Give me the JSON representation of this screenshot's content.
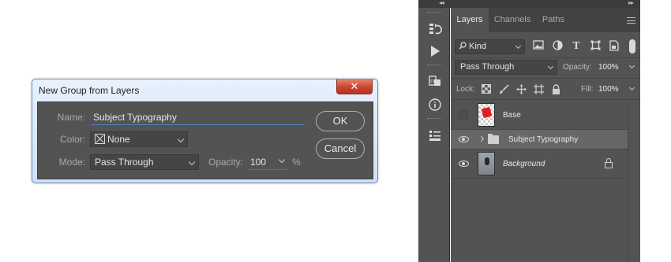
{
  "dialog": {
    "title": "New Group from Layers",
    "close_glyph": "✕",
    "name_label": "Name:",
    "name_value": "Subject Typography",
    "color_label": "Color:",
    "color_value": "None",
    "mode_label": "Mode:",
    "mode_value": "Pass Through",
    "opacity_label": "Opacity:",
    "opacity_value": "100",
    "opacity_unit": "%",
    "ok_label": "OK",
    "cancel_label": "Cancel"
  },
  "panel": {
    "strip_left_arrows": "◂◂",
    "strip_right_arrows": "▸▸",
    "tabs": [
      {
        "label": "Layers",
        "active": true
      },
      {
        "label": "Channels",
        "active": false
      },
      {
        "label": "Paths",
        "active": false
      }
    ],
    "filter": {
      "kind_value": "Kind",
      "icons": [
        "image-filter-icon",
        "adjustment-filter-icon",
        "type-filter-icon",
        "shape-filter-icon",
        "smart-object-filter-icon"
      ]
    },
    "blend_mode": "Pass Through",
    "opacity_label": "Opacity:",
    "opacity_value": "100%",
    "lock_label": "Lock:",
    "fill_label": "Fill:",
    "fill_value": "100%",
    "layers": [
      {
        "name": "Base",
        "visible": false,
        "type": "pixel"
      },
      {
        "name": "Subject Typography",
        "visible": true,
        "type": "group",
        "selected": true
      },
      {
        "name": "Background",
        "visible": true,
        "type": "background",
        "locked": true
      }
    ]
  },
  "toolstrip": {
    "icons": [
      "history-icon",
      "actions-play-icon",
      "libraries-icon",
      "info-icon",
      "properties-icon"
    ]
  }
}
